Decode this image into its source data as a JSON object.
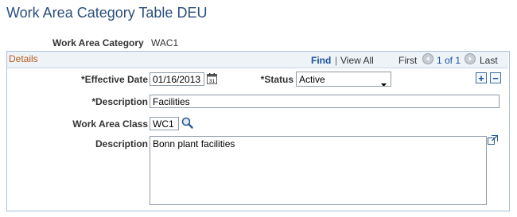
{
  "page": {
    "title": "Work Area Category Table DEU"
  },
  "key": {
    "label": "Work Area Category",
    "value": "WAC1"
  },
  "details": {
    "title": "Details",
    "nav": {
      "find": "Find",
      "separator": "|",
      "view_all": "View All",
      "first": "First",
      "count": "1 of 1",
      "last": "Last"
    }
  },
  "form": {
    "effective_date": {
      "label": "*Effective Date",
      "value": "01/16/2013"
    },
    "status": {
      "label": "*Status",
      "value": "Active"
    },
    "description": {
      "label": "*Description",
      "value": "Facilities"
    },
    "work_area_class": {
      "label": "Work Area Class",
      "value": "WC1"
    },
    "long_description": {
      "label": "Description",
      "value": "Bonn plant facilities"
    }
  },
  "row_actions": {
    "add": "+",
    "delete": "−"
  },
  "icons": {
    "calendar": "calendar-icon",
    "lookup": "magnifier-icon",
    "expand": "expand-icon",
    "prev": "prev-arrow-icon",
    "next": "next-arrow-icon"
  }
}
